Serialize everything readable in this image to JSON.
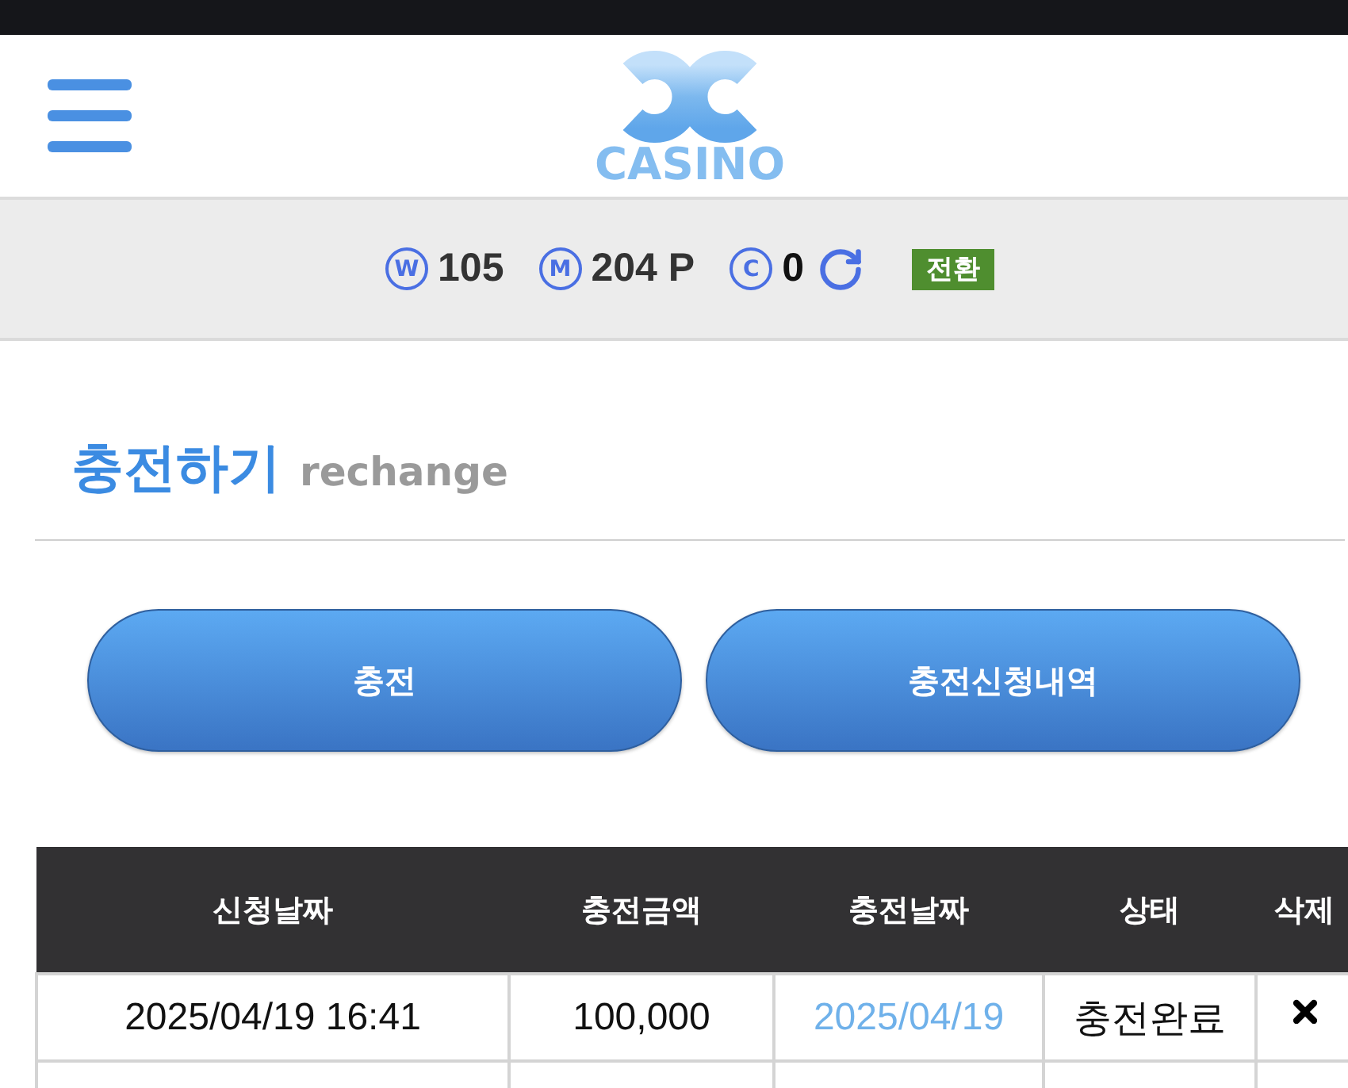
{
  "header": {
    "logo_text": "CASINO"
  },
  "balance": {
    "items": [
      {
        "symbol": "W",
        "amount": "105",
        "refresh": false
      },
      {
        "symbol": "M",
        "amount": "204 P",
        "refresh": false
      },
      {
        "symbol": "C",
        "amount": "0",
        "refresh": true
      }
    ],
    "convert_button": "전환"
  },
  "page_title": {
    "title": "충전하기",
    "subtitle": "rechange"
  },
  "actions": [
    {
      "label": "충전"
    },
    {
      "label": "충전신청내역"
    }
  ],
  "table": {
    "columns": [
      "신청날짜",
      "충전금액",
      "충전날짜",
      "상태",
      "삭제"
    ],
    "rows": [
      {
        "requested": "2025/04/19 16:41",
        "amount": "100,000",
        "charged_date": "2025/04/19",
        "status": "충전완료",
        "deletable": true
      }
    ]
  }
}
